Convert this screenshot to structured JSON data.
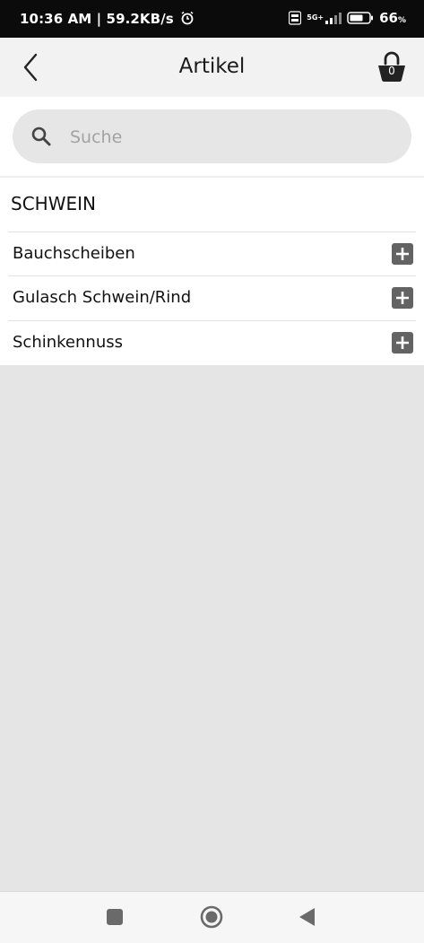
{
  "status_bar": {
    "time_speed": "10:36 AM | 59.2KB/s",
    "network": "5G+",
    "battery": "66"
  },
  "header": {
    "title": "Artikel",
    "cart_count": "0"
  },
  "search": {
    "placeholder": "Suche"
  },
  "section": {
    "title": "SCHWEIN",
    "items": [
      {
        "label": "Bauchscheiben"
      },
      {
        "label": "Gulasch Schwein/Rind"
      },
      {
        "label": "Schinkennuss"
      }
    ]
  }
}
